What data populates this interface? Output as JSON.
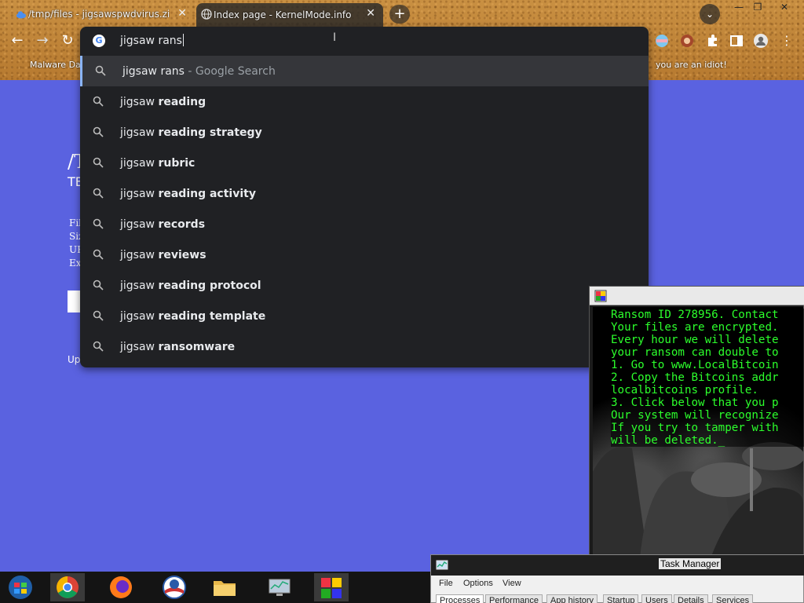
{
  "browser": {
    "tabs": [
      {
        "title": "/tmp/files - jigsawspwdvirus.zip",
        "active": false
      },
      {
        "title": "Index page - KernelMode.info",
        "active": true
      }
    ],
    "new_tab": "+",
    "tab_search": "⌄",
    "window_controls": {
      "minimize": "—",
      "maximize": "❐",
      "close": "✕"
    },
    "nav": {
      "back": "←",
      "forward": "→",
      "reload": "↻"
    },
    "bookmarks": {
      "left": "Malware Dat",
      "right": "you are an idiot!"
    }
  },
  "omnibox": {
    "input_value": "jigsaw rans",
    "suggestions": [
      {
        "prefix": "jigsaw rans",
        "suffix": "",
        "sub": " - Google Search",
        "selected": true
      },
      {
        "prefix": "jigsaw ",
        "suffix": "reading",
        "sub": ""
      },
      {
        "prefix": "jigsaw ",
        "suffix": "reading strategy",
        "sub": ""
      },
      {
        "prefix": "jigsaw ",
        "suffix": "rubric",
        "sub": ""
      },
      {
        "prefix": "jigsaw ",
        "suffix": "reading activity",
        "sub": ""
      },
      {
        "prefix": "jigsaw ",
        "suffix": "records",
        "sub": ""
      },
      {
        "prefix": "jigsaw ",
        "suffix": "reviews",
        "sub": ""
      },
      {
        "prefix": "jigsaw ",
        "suffix": "reading protocol",
        "sub": ""
      },
      {
        "prefix": "jigsaw ",
        "suffix": "reading template",
        "sub": ""
      },
      {
        "prefix": "jigsaw ",
        "suffix": "ransomware",
        "sub": ""
      }
    ]
  },
  "page": {
    "heading_frag": "/T",
    "sub_frag": "TE",
    "rows": [
      "Fil",
      "Siz",
      "UF",
      "Ex"
    ],
    "footer_frag": "Up"
  },
  "ransom_window": {
    "lines": [
      "Ransom ID 278956. Contact",
      "Your files are encrypted.",
      "Every hour we will delete",
      "your ransom can double to",
      "1. Go to www.LocalBitcoin",
      "2. Copy the Bitcoins addr",
      "localbitcoins profile.",
      "3. Click below that you p",
      "Our system will recognize",
      "If you try to tamper with",
      "will be deleted._"
    ]
  },
  "task_manager": {
    "title": "Task Manager",
    "menu": [
      "File",
      "Options",
      "View"
    ],
    "tabs": [
      "Processes",
      "Performance",
      "App history",
      "Startup",
      "Users",
      "Details",
      "Services"
    ]
  },
  "taskbar": {
    "items": [
      "start",
      "chrome",
      "firefox",
      "obama",
      "explorer",
      "monitor",
      "colors"
    ]
  }
}
